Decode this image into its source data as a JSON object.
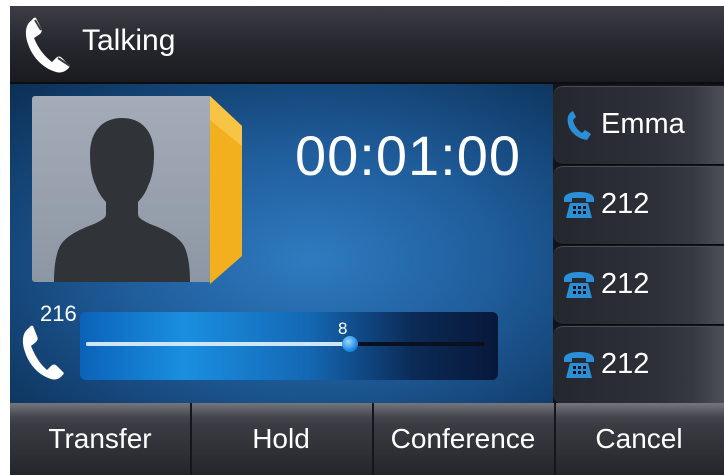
{
  "titlebar": {
    "title": "Talking",
    "icon": "handset-icon"
  },
  "call": {
    "duration": "00:01:00",
    "extension": "216",
    "avatar_icon": "contact-silhouette-icon"
  },
  "volume": {
    "value": "8",
    "level_fraction": 0.66
  },
  "lines": [
    {
      "label": "Emma",
      "icon": "handset-icon",
      "active": true
    },
    {
      "label": "212",
      "icon": "phone-icon",
      "active": false
    },
    {
      "label": "212",
      "icon": "phone-icon",
      "active": false
    },
    {
      "label": "212",
      "icon": "phone-icon",
      "active": false
    }
  ],
  "softkeys": [
    "Transfer",
    "Hold",
    "Conference",
    "Cancel"
  ],
  "colors": {
    "accent_blue": "#2b8fd8",
    "avatar_fold": "#f2b01e"
  }
}
